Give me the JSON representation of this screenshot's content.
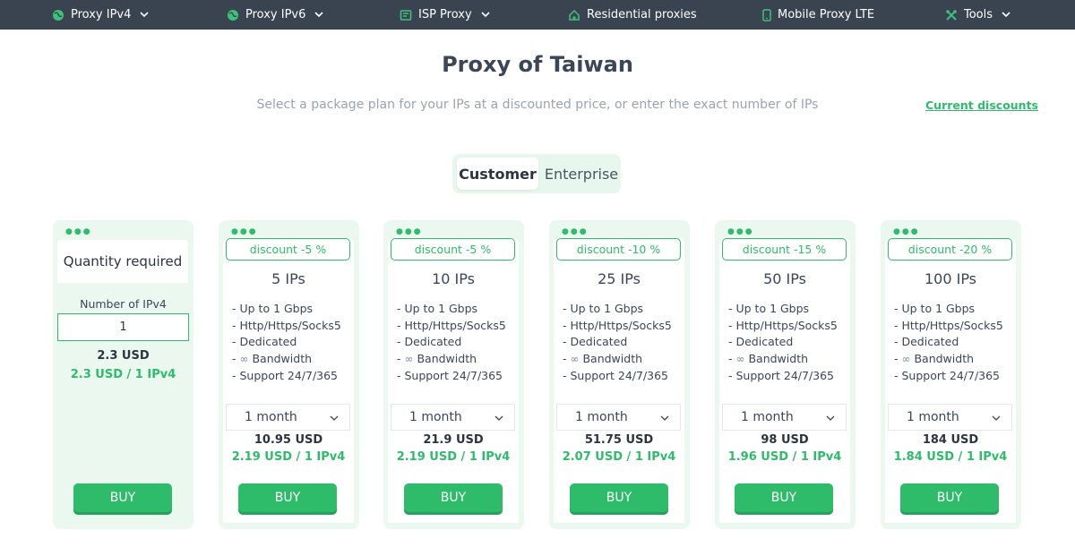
{
  "nav": {
    "items": [
      {
        "label": "Proxy IPv4",
        "icon": "globe-icon",
        "has_dropdown": true
      },
      {
        "label": "Proxy IPv6",
        "icon": "globe-icon",
        "has_dropdown": true
      },
      {
        "label": "ISP Proxy",
        "icon": "isp-icon",
        "has_dropdown": true
      },
      {
        "label": "Residential proxies",
        "icon": "home-icon",
        "has_dropdown": false
      },
      {
        "label": "Mobile Proxy LTE",
        "icon": "mobile-icon",
        "has_dropdown": false
      },
      {
        "label": "Tools",
        "icon": "tools-icon",
        "has_dropdown": true
      }
    ]
  },
  "page": {
    "title": "Proxy of Taiwan",
    "subtitle": "Select a package plan for your IPs at a discounted price, or enter the exact number of IPs",
    "discounts_link": "Current discounts"
  },
  "toggle": {
    "active": "Customer",
    "inactive": "Enterprise"
  },
  "quantity_card": {
    "heading": "Quantity required",
    "label": "Number of IPv4",
    "value": "1",
    "price": "2.3 USD",
    "unit_price": "2.3 USD / 1 IPv4",
    "buy_label": "BUY"
  },
  "plans": [
    {
      "discount": "discount -5 %",
      "ips": "5 IPs",
      "period": "1 month",
      "price": "10.95 USD",
      "unit_price": "2.19 USD / 1 IPv4",
      "buy_label": "BUY"
    },
    {
      "discount": "discount -5 %",
      "ips": "10 IPs",
      "period": "1 month",
      "price": "21.9 USD",
      "unit_price": "2.19 USD / 1 IPv4",
      "buy_label": "BUY"
    },
    {
      "discount": "discount -10 %",
      "ips": "25 IPs",
      "period": "1 month",
      "price": "51.75 USD",
      "unit_price": "2.07 USD / 1 IPv4",
      "buy_label": "BUY"
    },
    {
      "discount": "discount -15 %",
      "ips": "50 IPs",
      "period": "1 month",
      "price": "98 USD",
      "unit_price": "1.96 USD / 1 IPv4",
      "buy_label": "BUY"
    },
    {
      "discount": "discount -20 %",
      "ips": "100 IPs",
      "period": "1 month",
      "price": "184 USD",
      "unit_price": "1.84 USD / 1 IPv4",
      "buy_label": "BUY"
    }
  ],
  "features": [
    "- Up to 1 Gbps",
    "- Http/Https/Socks5",
    "- Dedicated",
    "- ",
    "Bandwidth",
    "- Support 24/7/365"
  ],
  "colors": {
    "accent": "#2ebb6a",
    "nav_bg": "#3a4350",
    "card_bg": "#eaf8ef"
  }
}
